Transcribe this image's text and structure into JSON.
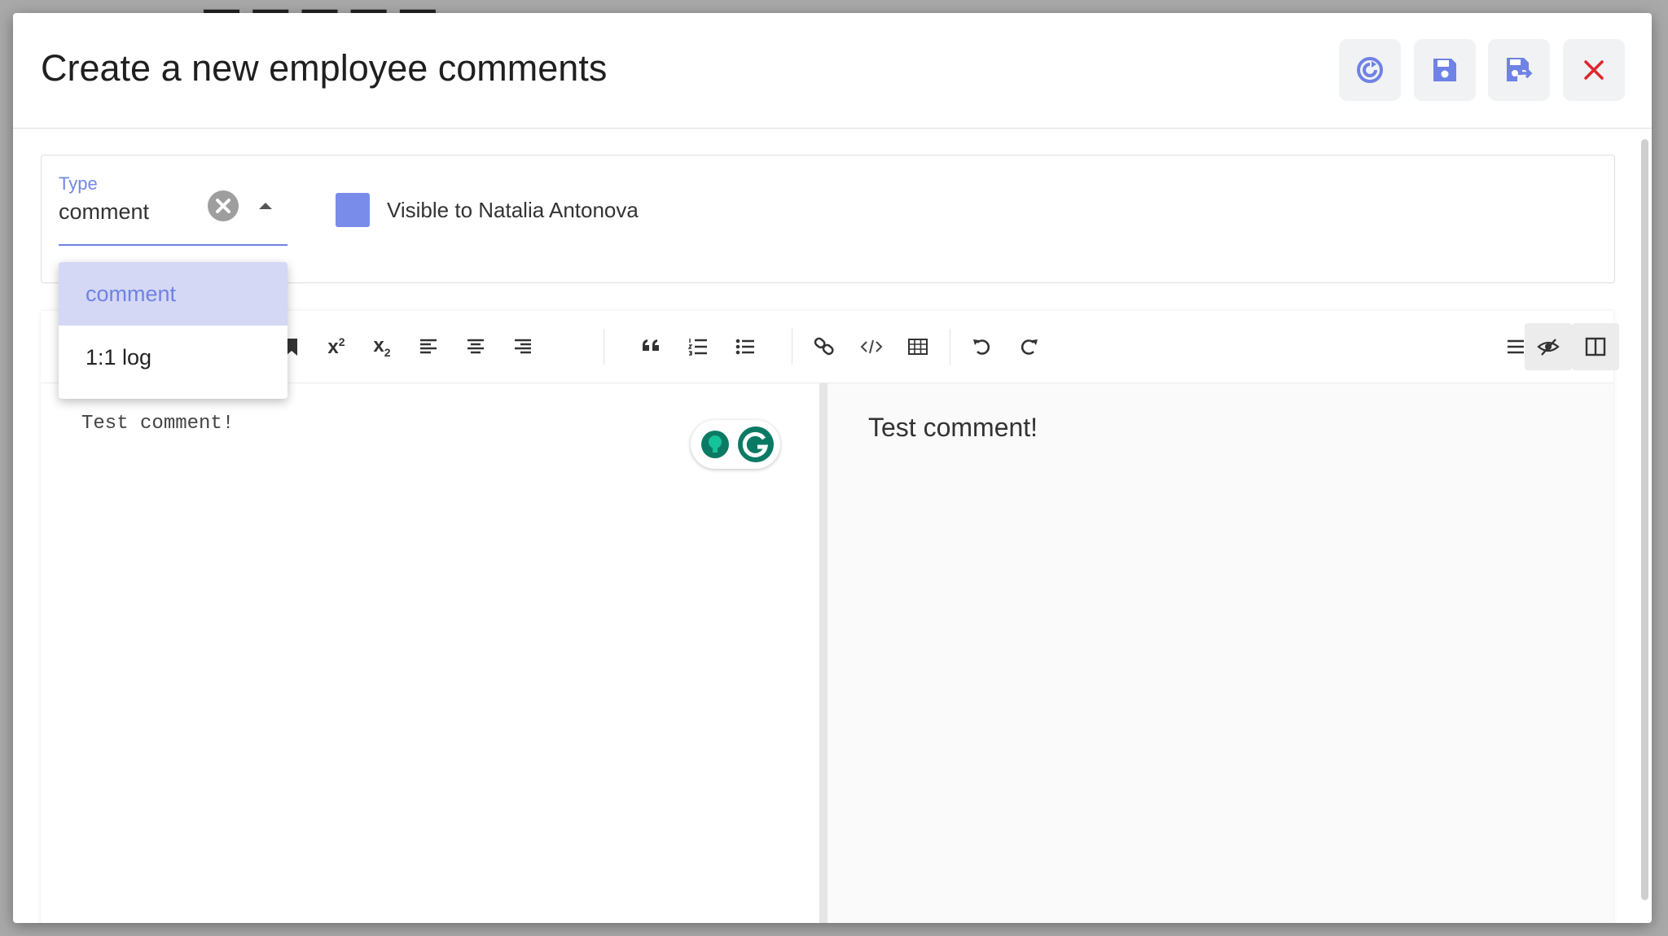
{
  "dialog": {
    "title": "Create a new employee comments",
    "actions": {
      "refresh": "refresh-icon",
      "save": "save-icon",
      "save_and_close": "save-and-close-icon",
      "close": "close-icon"
    }
  },
  "type_field": {
    "label": "Type",
    "value": "comment",
    "options": [
      "comment",
      "1:1 log"
    ],
    "selected_index": 0
  },
  "visibility": {
    "label": "Visible to Natalia Antonova",
    "color": "#7a8cea"
  },
  "toolbar": {
    "icons": [
      "bookmark-icon",
      "superscript-icon",
      "subscript-icon",
      "align-left-icon",
      "align-center-icon",
      "align-right-icon",
      "quote-icon",
      "ordered-list-icon",
      "unordered-list-icon",
      "link-icon",
      "code-icon",
      "table-icon",
      "undo-icon",
      "redo-icon",
      "menu-icon",
      "preview-toggle-icon",
      "side-by-side-icon"
    ],
    "superscript_base": "x",
    "superscript_exp": "2",
    "subscript_base": "x",
    "subscript_sub": "2"
  },
  "editor": {
    "source_text": "Test comment!",
    "preview_text": "Test comment!"
  },
  "colors": {
    "accent": "#6f82e6",
    "close": "#e0262d",
    "grammarly_green": "#15c39a",
    "grammarly_dark": "#0b7a64"
  }
}
